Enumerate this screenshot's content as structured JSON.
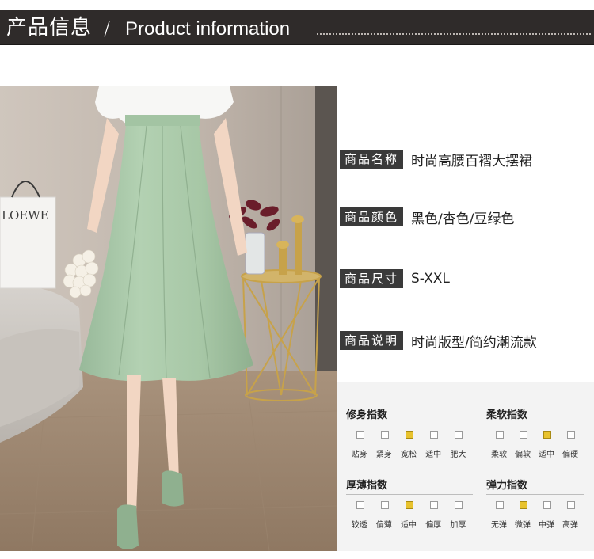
{
  "header": {
    "title_cn": "产品信息",
    "separator": "/",
    "title_en": "Product information"
  },
  "photo": {
    "bag_brand": "LOEWE"
  },
  "info": [
    {
      "label": "商品名称",
      "value": "时尚高腰百褶大摆裙"
    },
    {
      "label": "商品颜色",
      "value": "黑色/杏色/豆绿色"
    },
    {
      "label": "商品尺寸",
      "value": "S-XXL"
    },
    {
      "label": "商品说明",
      "value": "时尚版型/简约潮流款"
    }
  ],
  "indices": [
    {
      "title": "修身指数",
      "options": [
        "贴身",
        "紧身",
        "宽松",
        "适中",
        "肥大"
      ],
      "selected": 2
    },
    {
      "title": "柔软指数",
      "options": [
        "柔软",
        "偏软",
        "适中",
        "偏硬"
      ],
      "selected": 2
    },
    {
      "title": "厚薄指数",
      "options": [
        "较透",
        "偏薄",
        "适中",
        "偏厚",
        "加厚"
      ],
      "selected": 2
    },
    {
      "title": "弹力指数",
      "options": [
        "无弹",
        "微弹",
        "中弹",
        "高弹"
      ],
      "selected": 1
    }
  ],
  "colors": {
    "banner_bg": "#2f2b2a",
    "label_bg": "#3a3a3a",
    "selected_box": "#e8c22d",
    "skirt": "#a9c9a8",
    "panel_bg": "#f3f3f3"
  }
}
